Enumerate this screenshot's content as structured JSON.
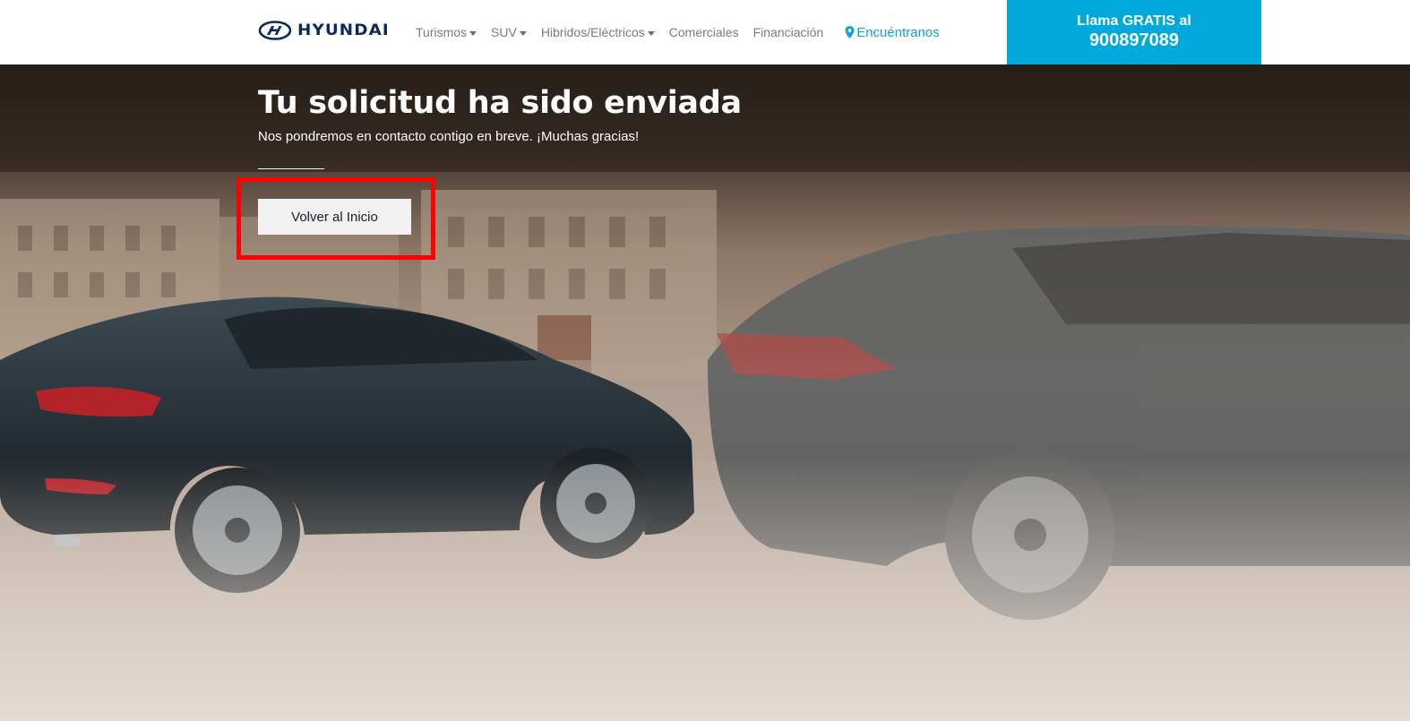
{
  "header": {
    "logo_text": "HYUNDAI",
    "nav": [
      {
        "label": "Turismos",
        "has_dropdown": true
      },
      {
        "label": "SUV",
        "has_dropdown": true
      },
      {
        "label": "Hibridos/Eléctricos",
        "has_dropdown": true
      },
      {
        "label": "Comerciales",
        "has_dropdown": false
      },
      {
        "label": "Financiación",
        "has_dropdown": false
      }
    ],
    "locate": {
      "label": "Encuéntranos",
      "icon": "map-pin-icon"
    },
    "call": {
      "line1": "Llama GRATIS al",
      "phone": "900897089"
    }
  },
  "hero": {
    "title": "Tu solicitud ha sido enviada",
    "subtitle": "Nos pondremos en contacto contigo en breve. ¡Muchas gracias!",
    "button_label": "Volver al Inicio"
  },
  "colors": {
    "brand_navy": "#0b2a5b",
    "call_bg": "#00a8dc",
    "link_blue": "#11a3d2",
    "highlight_red": "#ff0000",
    "button_bg": "#f1f1f1"
  }
}
